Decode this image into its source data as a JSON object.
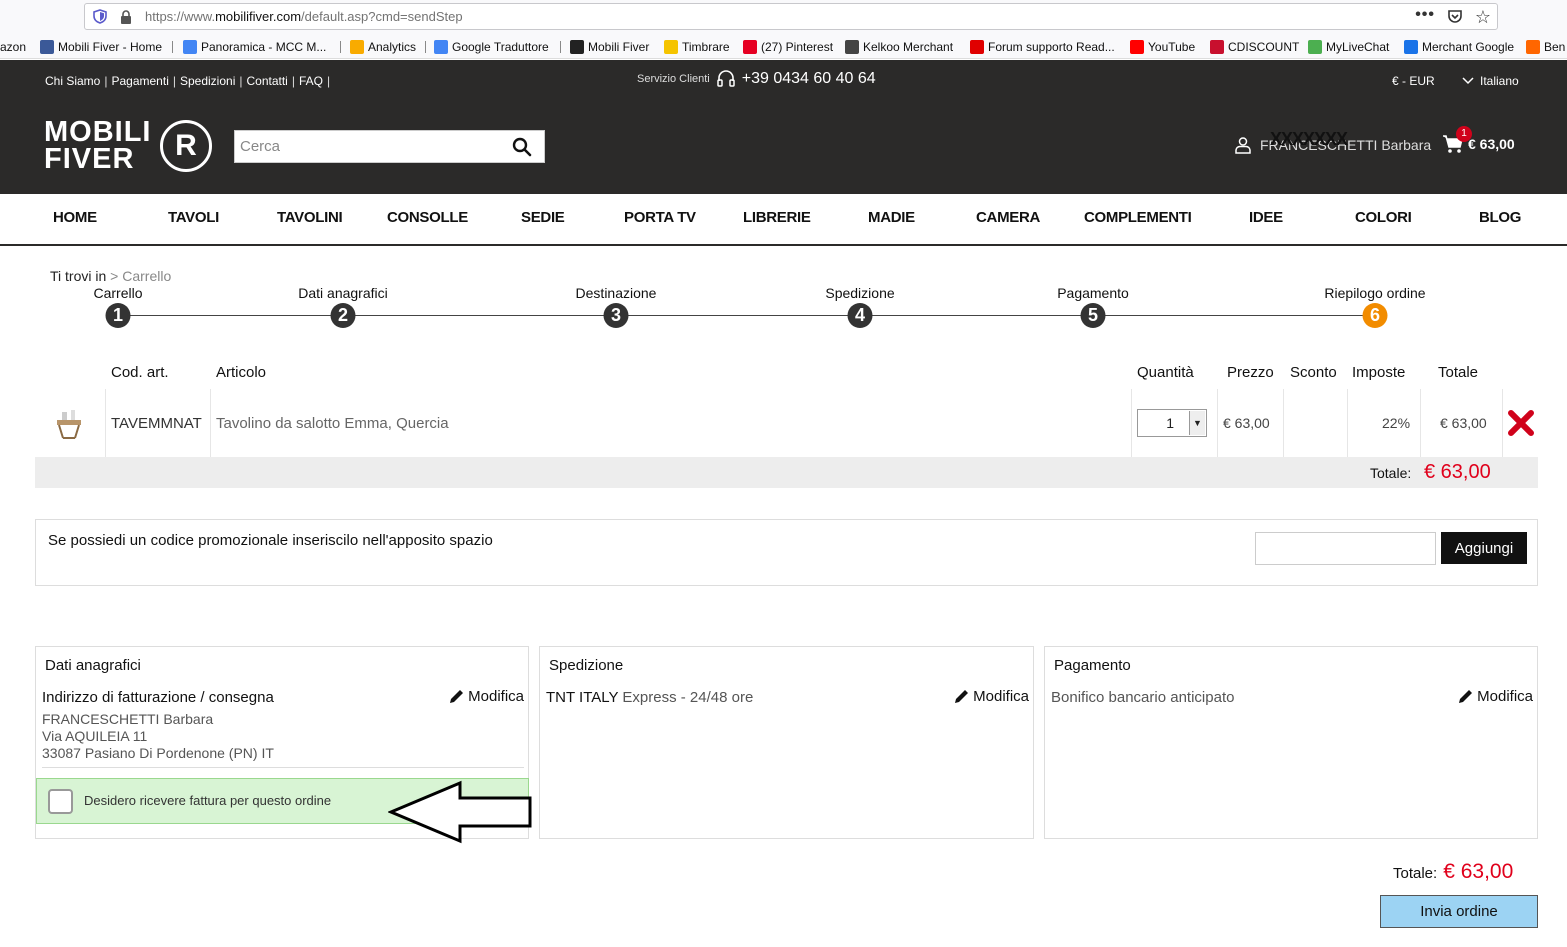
{
  "browser": {
    "url_prefix": "https://www.",
    "url_domain": "mobilifiver.com",
    "url_path": "/default.asp?cmd=sendStep",
    "menu_dots": "•••",
    "bookmarks": [
      {
        "label": "azon",
        "color": "#ff9900"
      },
      {
        "label": "Mobili Fiver - Home",
        "color": "#3b5998"
      },
      {
        "label": "Panoramica - MCC M...",
        "color": "#4285f4"
      },
      {
        "label": "Analytics",
        "color": "#f9ab00"
      },
      {
        "label": "Google Traduttore",
        "color": "#4285f4"
      },
      {
        "label": "Mobili Fiver",
        "color": "#222222"
      },
      {
        "label": "Timbrare",
        "color": "#f5c400"
      },
      {
        "label": "(27) Pinterest",
        "color": "#e60023"
      },
      {
        "label": "Kelkoo Merchant",
        "color": "#444444"
      },
      {
        "label": "Forum supporto Read...",
        "color": "#e00000"
      },
      {
        "label": "YouTube",
        "color": "#ff0000"
      },
      {
        "label": "CDISCOUNT",
        "color": "#c8102e"
      },
      {
        "label": "MyLiveChat",
        "color": "#4caf50"
      },
      {
        "label": "Merchant Google",
        "color": "#1a73e8"
      },
      {
        "label": "Ben",
        "color": "#ff6600"
      }
    ]
  },
  "topbar": {
    "links": [
      "Chi Siamo",
      "Pagamenti",
      "Spedizioni",
      "Contatti",
      "FAQ"
    ],
    "service_label": "Servizio Clienti",
    "phone": "+39 0434 60 40 64",
    "currency": "€ - EUR",
    "language": "Italiano"
  },
  "header": {
    "logo_line1": "MOBILI",
    "logo_line2": "FIVER",
    "logo_mark": "R",
    "search_placeholder": "Cerca",
    "user_name": "FRANCESCHETTI Barbara",
    "user_scribble": "XXXXXXX",
    "cart_count": "1",
    "cart_total": "€ 63,00"
  },
  "nav": [
    "HOME",
    "TAVOLI",
    "TAVOLINI",
    "CONSOLLE",
    "SEDIE",
    "PORTA TV",
    "LIBRERIE",
    "MADIE",
    "CAMERA",
    "COMPLEMENTI",
    "IDEE",
    "COLORI",
    "BLOG"
  ],
  "breadcrumb": {
    "prefix": "Ti trovi in",
    "sep": ">",
    "current": "Carrello"
  },
  "steps": [
    {
      "label": "Carrello",
      "num": "1"
    },
    {
      "label": "Dati anagrafici",
      "num": "2"
    },
    {
      "label": "Destinazione",
      "num": "3"
    },
    {
      "label": "Spedizione",
      "num": "4"
    },
    {
      "label": "Pagamento",
      "num": "5"
    },
    {
      "label": "Riepilogo ordine",
      "num": "6"
    }
  ],
  "active_step": "6",
  "cart": {
    "headers": {
      "code": "Cod. art.",
      "article": "Articolo",
      "qty": "Quantità",
      "price": "Prezzo",
      "discount": "Sconto",
      "tax": "Imposte",
      "total": "Totale"
    },
    "row": {
      "code": "TAVEMMNAT",
      "article": "Tavolino da salotto Emma, Quercia",
      "qty": "1",
      "price": "€ 63,00",
      "discount": "",
      "tax": "22%",
      "total": "€ 63,00"
    },
    "total_label": "Totale:",
    "total_value": "€ 63,00"
  },
  "promo": {
    "text": "Se possiedi un codice promozionale inseriscilo nell'apposito spazio",
    "button": "Aggiungi"
  },
  "summary": {
    "edit_label": "Modifica",
    "personal": {
      "title": "Dati anagrafici",
      "subtitle": "Indirizzo di fatturazione / consegna",
      "name": "FRANCESCHETTI Barbara",
      "street": "Via AQUILEIA 11",
      "city": "33087 Pasiano Di Pordenone (PN) IT",
      "invoice_label": "Desidero ricevere fattura per questo ordine"
    },
    "shipping": {
      "title": "Spedizione",
      "carrier": "TNT ITALY",
      "service": "Express - 24/48 ore"
    },
    "payment": {
      "title": "Pagamento",
      "method": "Bonifico bancario anticipato"
    }
  },
  "footer": {
    "total_label": "Totale:",
    "total_value": "€ 63,00",
    "send_button": "Invia ordine"
  }
}
